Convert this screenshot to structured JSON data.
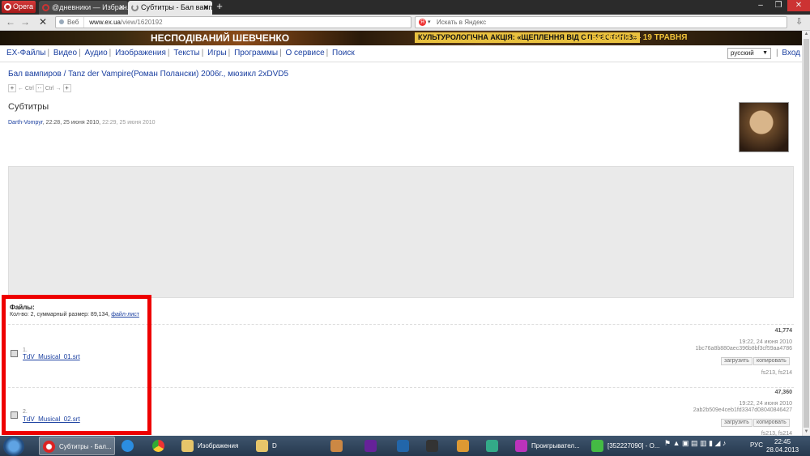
{
  "browser": {
    "menu_label": "Opera",
    "tabs": [
      {
        "label": "@дневники — Избран..."
      },
      {
        "label": "Субтитры - Бал вампи..."
      }
    ],
    "new_tab": "+",
    "address_prefix": "Веб",
    "url_host": "www.ex.ua",
    "url_path": "/view/1620192",
    "search_placeholder": "Искать в Яндекс"
  },
  "banner": {
    "left_a": "НЕСПОДІВАНИЙ",
    "left_b": "ШЕВЧЕНКО",
    "middle": "КУЛЬТУРОЛОГІЧНА АКЦІЯ: «ЩЕПЛЕННЯ ВІД СТЕРЕОТИПІВ»",
    "right": "1 БЕРЕЗНЯ — 19 ТРАВНЯ"
  },
  "site_nav": {
    "logo": "EX-Файлы",
    "items": [
      "Видео",
      "Аудио",
      "Изображения",
      "Тексты",
      "Игры",
      "Программы",
      "О сервисе",
      "Поиск"
    ],
    "language": "русский",
    "login": "Вход"
  },
  "breadcrumb": "Бал вампиров / Tanz der Vampire(Роман Полански) 2006г., мюзикл 2xDVD5",
  "ctrl_nav": {
    "prev": "← Ctrl",
    "next": "Ctrl →"
  },
  "page_title": "Субтитры",
  "meta": {
    "author": "Darth-Vompyr",
    "created": ", 22:28, 25 июня 2010, ",
    "edited": "22:29, 25 июня 2010"
  },
  "files": {
    "heading": "Файлы:",
    "summary": "Кол-во: 2, суммарный размер: 89,134, ",
    "file_list_link": "файл-лист",
    "items": [
      {
        "num": "1.",
        "name": "TdV_Musical_01.srt",
        "size": "41,774",
        "date": "19:22, 24 июня 2010",
        "hash": "1bc76a8b880aec396b8bf3cf59aa4786",
        "download": "загрузить",
        "copy": "копировать",
        "servers": "fs213, fs214"
      },
      {
        "num": "2.",
        "name": "TdV_Musical_02.srt",
        "size": "47,360",
        "date": "19:22, 24 июня 2010",
        "hash": "2ab2b509e4ceb1fd3347d08040846427",
        "download": "загрузить",
        "copy": "копировать",
        "servers": "fs213, fs214"
      }
    ]
  },
  "taskbar": {
    "items": [
      {
        "label": "Субтитры - Бал..."
      },
      {
        "label": "Изображения"
      },
      {
        "label": "D"
      },
      {
        "label": "Проигрывател..."
      },
      {
        "label": "[352227090] - О..."
      }
    ],
    "language": "РУС",
    "time": "22:45",
    "date": "28.04.2013"
  }
}
